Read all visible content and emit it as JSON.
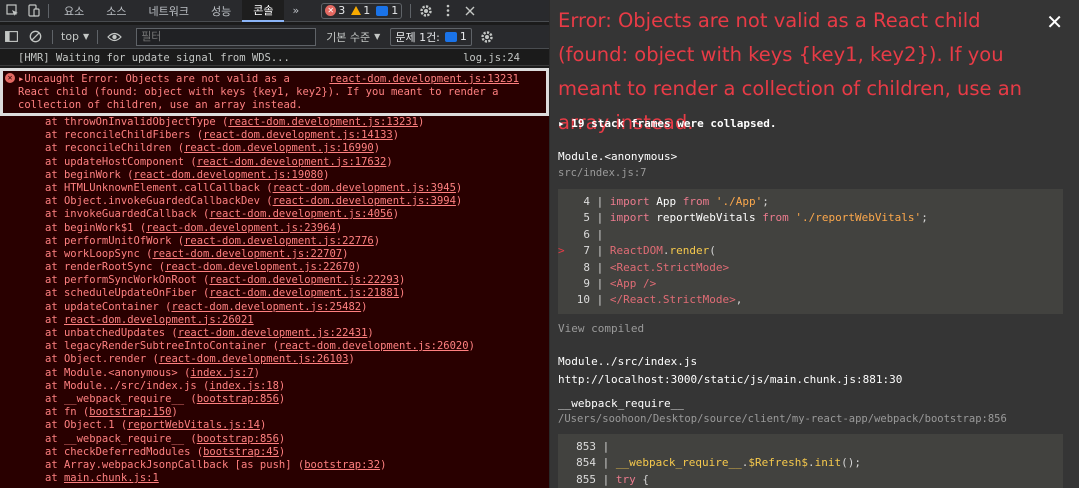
{
  "devtools": {
    "tabs": [
      "요소",
      "소스",
      "네트워크",
      "성능",
      "콘솔"
    ],
    "active_tab": "콘솔",
    "more_tabs_glyph": "»",
    "error_count": "3",
    "warning_count": "1",
    "message_count": "1",
    "toolbar": {
      "context": "top",
      "filter_placeholder": "필터",
      "level": "기본 수준",
      "issues_label": "문제 1건:",
      "issues_count": "1"
    },
    "hmr": {
      "text": "[HMR] Waiting for update signal from WDS...",
      "source": "log.js:24"
    },
    "error": {
      "line1": "▸Uncaught Error: Objects are not valid as a",
      "source": "react-dom.development.js:13231",
      "line2": "React child (found: object with keys {key1, key2}). If you meant to render a",
      "line3": "collection of children, use an array instead."
    },
    "stack": [
      {
        "fn": "at throwOnInvalidObjectType",
        "loc": "react-dom.development.js:13231"
      },
      {
        "fn": "at reconcileChildFibers",
        "loc": "react-dom.development.js:14133"
      },
      {
        "fn": "at reconcileChildren",
        "loc": "react-dom.development.js:16990"
      },
      {
        "fn": "at updateHostComponent",
        "loc": "react-dom.development.js:17632"
      },
      {
        "fn": "at beginWork",
        "loc": "react-dom.development.js:19080"
      },
      {
        "fn": "at HTMLUnknownElement.callCallback",
        "loc": "react-dom.development.js:3945"
      },
      {
        "fn": "at Object.invokeGuardedCallbackDev",
        "loc": "react-dom.development.js:3994"
      },
      {
        "fn": "at invokeGuardedCallback",
        "loc": "react-dom.development.js:4056"
      },
      {
        "fn": "at beginWork$1",
        "loc": "react-dom.development.js:23964"
      },
      {
        "fn": "at performUnitOfWork",
        "loc": "react-dom.development.js:22776"
      },
      {
        "fn": "at workLoopSync",
        "loc": "react-dom.development.js:22707"
      },
      {
        "fn": "at renderRootSync",
        "loc": "react-dom.development.js:22670"
      },
      {
        "fn": "at performSyncWorkOnRoot",
        "loc": "react-dom.development.js:22293"
      },
      {
        "fn": "at scheduleUpdateOnFiber",
        "loc": "react-dom.development.js:21881"
      },
      {
        "fn": "at updateContainer",
        "loc": "react-dom.development.js:25482"
      },
      {
        "fn": "at",
        "loc": "react-dom.development.js:26021",
        "bare": true
      },
      {
        "fn": "at unbatchedUpdates",
        "loc": "react-dom.development.js:22431"
      },
      {
        "fn": "at legacyRenderSubtreeIntoContainer",
        "loc": "react-dom.development.js:26020"
      },
      {
        "fn": "at Object.render",
        "loc": "react-dom.development.js:26103"
      },
      {
        "fn": "at Module.<anonymous>",
        "loc": "index.js:7"
      },
      {
        "fn": "at Module../src/index.js",
        "loc": "index.js:18"
      },
      {
        "fn": "at __webpack_require__",
        "loc": "bootstrap:856"
      },
      {
        "fn": "at fn",
        "loc": "bootstrap:150"
      },
      {
        "fn": "at Object.1",
        "loc": "reportWebVitals.js:14"
      },
      {
        "fn": "at __webpack_require__",
        "loc": "bootstrap:856"
      },
      {
        "fn": "at checkDeferredModules",
        "loc": "bootstrap:45"
      },
      {
        "fn": "at Array.webpackJsonpCallback [as push]",
        "loc": "bootstrap:32"
      },
      {
        "fn": "at",
        "loc": "main.chunk.js:1",
        "bare": true
      }
    ]
  },
  "overlay": {
    "title": "Error: Objects are not valid as a React child (found: object with keys {key1, key2}). If you meant to render a collection of children, use an array instead.",
    "close_glyph": "✕",
    "collapsed": "▸ 19 stack frames were collapsed.",
    "frame1": {
      "name": "Module.<anonymous>",
      "path": "src/index.js:7"
    },
    "code1": [
      {
        "n": "4",
        "mark": "",
        "t": "import App from './App';"
      },
      {
        "n": "5",
        "mark": "",
        "t": "import reportWebVitals from './reportWebVitals';"
      },
      {
        "n": "6",
        "mark": "",
        "t": ""
      },
      {
        "n": "7",
        "mark": ">",
        "t": "ReactDOM.render("
      },
      {
        "n": "8",
        "mark": "",
        "t": "<React.StrictMode>"
      },
      {
        "n": "9",
        "mark": "",
        "t": "<App />"
      },
      {
        "n": "10",
        "mark": "",
        "t": "</React.StrictMode>,"
      }
    ],
    "view_compiled": "View compiled",
    "frame2": {
      "name": "Module../src/index.js",
      "path": "http://localhost:3000/static/js/main.chunk.js:881:30"
    },
    "frame3": {
      "name": "__webpack_require__",
      "path": "/Users/soohoon/Desktop/source/client/my-react-app/webpack/bootstrap:856"
    },
    "code2": [
      {
        "n": "853",
        "t": ""
      },
      {
        "n": "854",
        "t": "__webpack_require__.$Refresh$.init();"
      },
      {
        "n": "855",
        "t": "try {"
      }
    ]
  },
  "colors": {
    "error_red": "#e83b46",
    "console_error_bg": "#290000",
    "overlay_bg": "#353535"
  }
}
